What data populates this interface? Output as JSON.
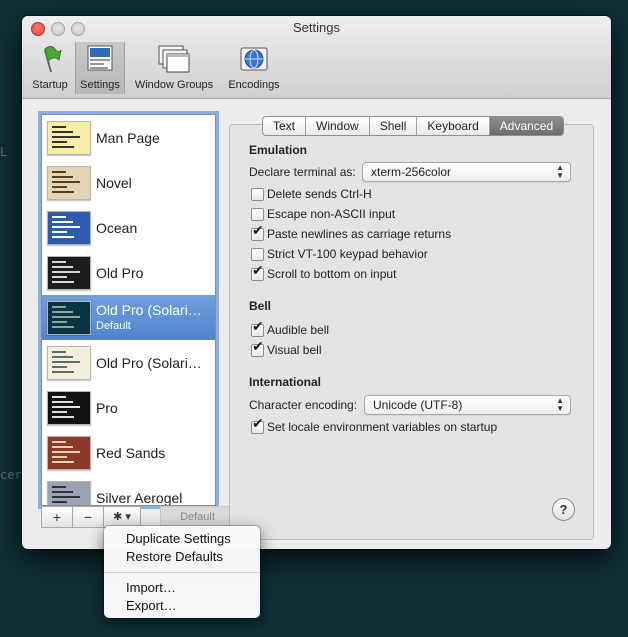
{
  "window": {
    "title": "Settings"
  },
  "toolbar": [
    {
      "label": "Startup",
      "icon": "startup-flag-icon"
    },
    {
      "label": "Settings",
      "icon": "settings-profiles-icon"
    },
    {
      "label": "Window Groups",
      "icon": "window-groups-icon"
    },
    {
      "label": "Encodings",
      "icon": "encodings-globe-icon"
    }
  ],
  "profiles": [
    {
      "name": "Man Page",
      "sub": "",
      "bg": "#f7eda8",
      "fg": "#333333"
    },
    {
      "name": "Novel",
      "sub": "",
      "bg": "#e2d6b6",
      "fg": "#5a3e1e"
    },
    {
      "name": "Ocean",
      "sub": "",
      "bg": "#2d5cae",
      "fg": "#ffffff"
    },
    {
      "name": "Old Pro",
      "sub": "",
      "bg": "#1c1c1c",
      "fg": "#d8d8d8"
    },
    {
      "name": "Old Pro (Solari…",
      "sub": "Default",
      "bg": "#073642",
      "fg": "#93a1a1"
    },
    {
      "name": "Old Pro (Solari…",
      "sub": "",
      "bg": "#f3efdc",
      "fg": "#586e75"
    },
    {
      "name": "Pro",
      "sub": "",
      "bg": "#111111",
      "fg": "#e0e0e0"
    },
    {
      "name": "Red Sands",
      "sub": "",
      "bg": "#8b3a2a",
      "fg": "#e8d0b0"
    },
    {
      "name": "Silver Aerogel",
      "sub": "",
      "bg": "#9aa3b3",
      "fg": "#333333"
    }
  ],
  "list_buttons": {
    "add": "+",
    "remove": "−",
    "gear": "✱ ▾",
    "default": "Default"
  },
  "tabs": [
    {
      "label": "Text"
    },
    {
      "label": "Window"
    },
    {
      "label": "Shell"
    },
    {
      "label": "Keyboard"
    },
    {
      "label": "Advanced"
    }
  ],
  "active_tab": "Advanced",
  "emulation": {
    "heading": "Emulation",
    "declare_label": "Declare terminal as:",
    "declare_value": "xterm-256color",
    "options": [
      {
        "label": "Delete sends Ctrl-H",
        "checked": false
      },
      {
        "label": "Escape non-ASCII input",
        "checked": false
      },
      {
        "label": "Paste newlines as carriage returns",
        "checked": true
      },
      {
        "label": "Strict VT-100 keypad behavior",
        "checked": false
      },
      {
        "label": "Scroll to bottom on input",
        "checked": true
      }
    ]
  },
  "bell": {
    "heading": "Bell",
    "options": [
      {
        "label": "Audible bell",
        "checked": true
      },
      {
        "label": "Visual bell",
        "checked": true
      }
    ]
  },
  "international": {
    "heading": "International",
    "encoding_label": "Character encoding:",
    "encoding_value": "Unicode (UTF-8)",
    "locale_option": {
      "label": "Set locale environment variables on startup",
      "checked": true
    }
  },
  "help_label": "?",
  "check_glyph": "✔",
  "popup_menu": [
    "Duplicate Settings",
    "Restore Defaults",
    "Import…",
    "Export…"
  ],
  "background_fragments": [
    "L",
    "cer"
  ]
}
